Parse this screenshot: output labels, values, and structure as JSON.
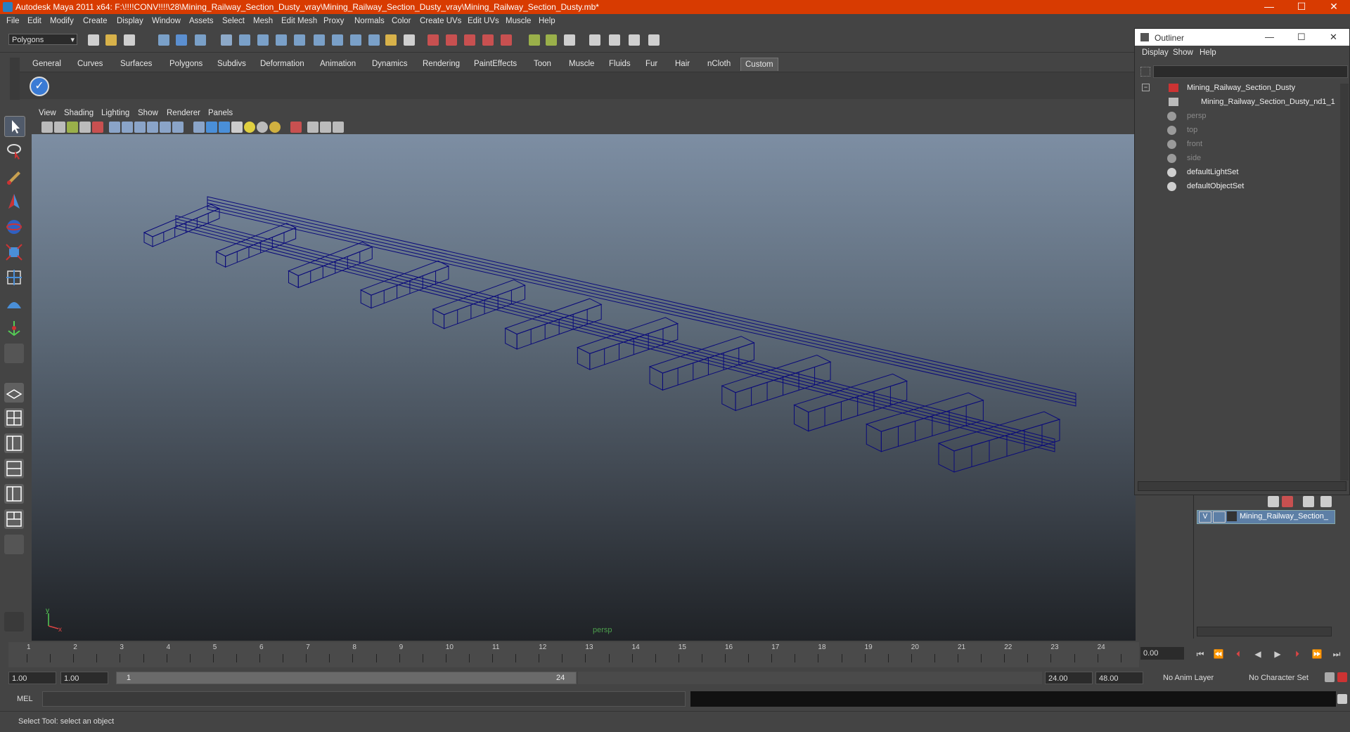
{
  "window": {
    "title": "Autodesk Maya 2011 x64: F:\\!!!!CONV!!!!\\28\\Mining_Railway_Section_Dusty_vray\\Mining_Railway_Section_Dusty_vray\\Mining_Railway_Section_Dusty.mb*",
    "controls": [
      "—",
      "☐",
      "✕"
    ]
  },
  "menubar": [
    "File",
    "Edit",
    "Modify",
    "Create",
    "Display",
    "Window",
    "Assets",
    "Select",
    "Mesh",
    "Edit Mesh",
    "Proxy",
    "Normals",
    "Color",
    "Create UVs",
    "Edit UVs",
    "Muscle",
    "Help"
  ],
  "statusline": {
    "mode": "Polygons"
  },
  "shelf": {
    "tabs": [
      "General",
      "Curves",
      "Surfaces",
      "Polygons",
      "Subdivs",
      "Deformation",
      "Animation",
      "Dynamics",
      "Rendering",
      "PaintEffects",
      "Toon",
      "Muscle",
      "Fluids",
      "Fur",
      "Hair",
      "nCloth",
      "Custom"
    ],
    "active": "Custom"
  },
  "viewport": {
    "menu": [
      "View",
      "Shading",
      "Lighting",
      "Show",
      "Renderer",
      "Panels"
    ],
    "camera_label": "persp",
    "axis_y": "y",
    "axis_x": "x",
    "wire_color": "#0a0a7a"
  },
  "outliner": {
    "title": "Outliner",
    "menu": [
      "Display",
      "Show",
      "Help"
    ],
    "items": [
      {
        "label": "Mining_Railway_Section_Dusty",
        "dim": false
      },
      {
        "label": "Mining_Railway_Section_Dusty_nd1_1",
        "dim": false
      },
      {
        "label": "persp",
        "dim": true
      },
      {
        "label": "top",
        "dim": true
      },
      {
        "label": "front",
        "dim": true
      },
      {
        "label": "side",
        "dim": true
      },
      {
        "label": "defaultLightSet",
        "dim": false
      },
      {
        "label": "defaultObjectSet",
        "dim": false
      }
    ]
  },
  "layers": {
    "visible_flag": "V",
    "layer_name": "Mining_Railway_Section_"
  },
  "timeslider": {
    "ticks": [
      "1",
      "2",
      "3",
      "4",
      "5",
      "6",
      "7",
      "8",
      "9",
      "10",
      "11",
      "12",
      "13",
      "14",
      "15",
      "16",
      "17",
      "18",
      "19",
      "20",
      "21",
      "22",
      "23",
      "24"
    ],
    "current_time": "0.00"
  },
  "range": {
    "start": "1.00",
    "playback_start": "1.00",
    "slider_start": "1",
    "slider_end": "24",
    "playback_end": "24.00",
    "end": "48.00",
    "anim_layer": "No Anim Layer",
    "character_set": "No Character Set"
  },
  "cmdline": {
    "label": "MEL"
  },
  "helpline": {
    "text": "Select Tool: select an object"
  }
}
